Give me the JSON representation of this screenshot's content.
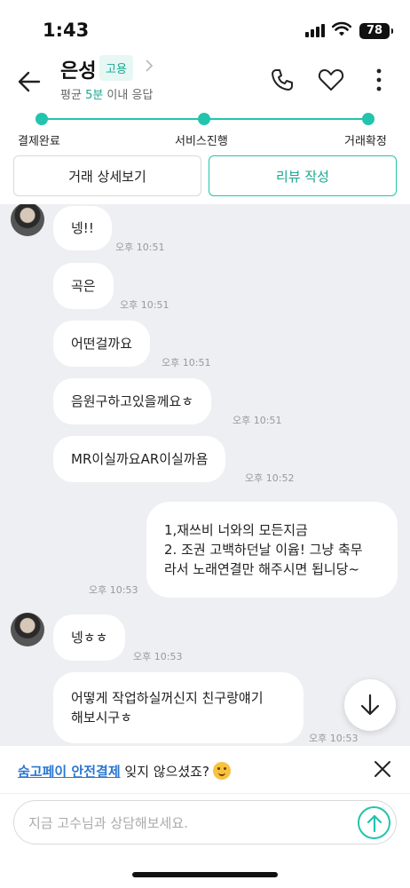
{
  "status_bar": {
    "time": "1:43",
    "battery": "78"
  },
  "header": {
    "name": "은성",
    "tag": "고용",
    "response_prefix": "평균 ",
    "response_highlight": "5분",
    "response_suffix": " 이내 응답"
  },
  "progress": {
    "steps": [
      "결제완료",
      "서비스진행",
      "거래확정"
    ],
    "accent": "#22c4ad"
  },
  "actions": {
    "detail_label": "거래 상세보기",
    "review_label": "리뷰 작성"
  },
  "messages": [
    {
      "side": "left",
      "text": "넹!!",
      "time": "오후 10:51"
    },
    {
      "side": "left",
      "text": "곡은",
      "time": "오후 10:51"
    },
    {
      "side": "left",
      "text": "어떤걸까요",
      "time": "오후 10:51"
    },
    {
      "side": "left",
      "text": "음원구하고있을께요ㅎ",
      "time": "오후 10:51"
    },
    {
      "side": "left",
      "text": "MR이실까요AR이실까욤",
      "time": "오후 10:52"
    },
    {
      "side": "right",
      "lines": [
        "1,재쓰비 너와의 모든지금",
        "2. 조권 고백하던날 이윱! 그냥 축무",
        "라서 노래연결만 해주시면 됩니당~"
      ],
      "time": "오후 10:53"
    },
    {
      "side": "left",
      "text": "넹ㅎㅎ",
      "time": "오후 10:53"
    },
    {
      "side": "left",
      "lines": [
        "어떻게 작업하실꺼신지 친구랑얘기",
        "해보시구ㅎ"
      ],
      "time": "오후 10:53"
    }
  ],
  "banner": {
    "link_text": "숨고페이 안전결제",
    "rest_text": " 잊지 않으셨죠?"
  },
  "input": {
    "placeholder": "지금 고수님과 상담해보세요."
  },
  "icons": {
    "back": "arrow-left-icon",
    "call": "phone-icon",
    "favorite": "heart-icon",
    "more": "more-vertical-icon",
    "scroll": "arrow-down-icon",
    "close": "close-icon",
    "send": "arrow-up-icon"
  }
}
